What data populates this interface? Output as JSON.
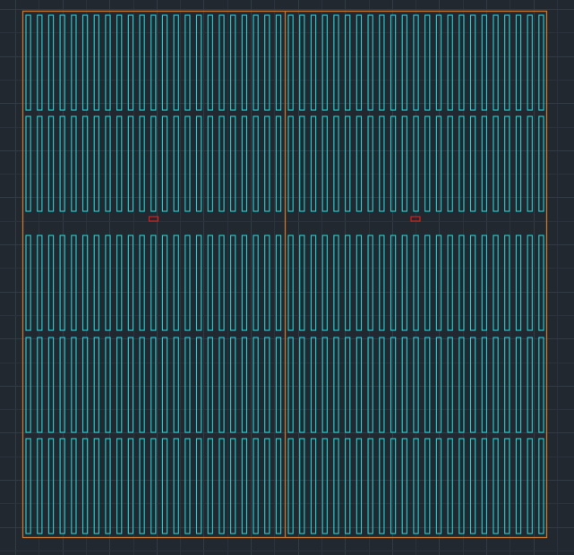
{
  "viewport": {
    "background_color": "#212830",
    "grid_minor_color": "#2b323b",
    "grid_major_color": "#323a44"
  },
  "boundary": {
    "color": "#c8762e",
    "split": "vertical-center"
  },
  "panels": {
    "color": "#23d3d6",
    "block_halves": 2,
    "rows": 5,
    "panels_per_half_row": 23
  },
  "markers": {
    "color": "#e02020",
    "count": 2
  }
}
